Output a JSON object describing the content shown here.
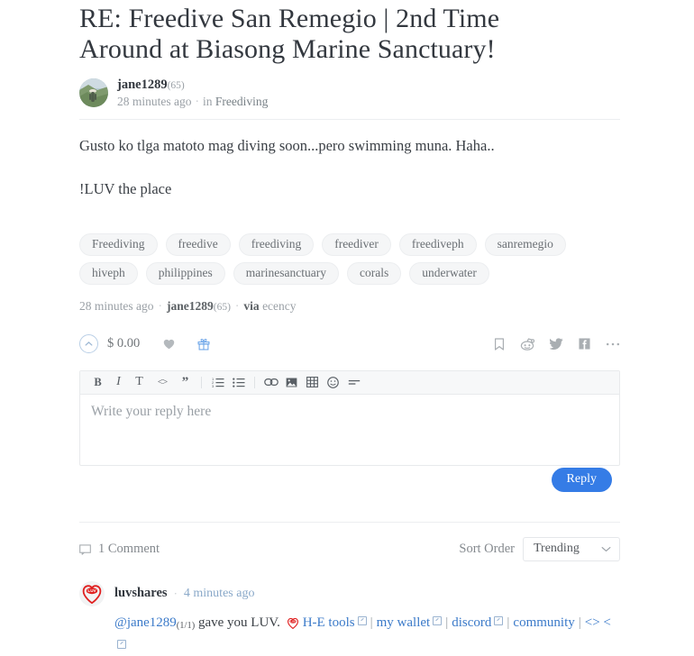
{
  "post": {
    "title": "RE: Freedive San Remegio | 2nd Time Around at Biasong Marine Sanctuary!",
    "author": "jane1289",
    "author_reputation": "(65)",
    "timestamp": "28 minutes ago",
    "in_label": "in",
    "community": "Freediving",
    "avatar_alt": "jane1289-avatar",
    "body_paragraphs": [
      "Gusto ko tlga matoto mag diving soon...pero swimming muna. Haha..",
      "!LUV the place"
    ],
    "tags": [
      "Freediving",
      "freedive",
      "freediving",
      "freediver",
      "freediveph",
      "sanremegio",
      "hiveph",
      "philippines",
      "marinesanctuary",
      "corals",
      "underwater"
    ],
    "footer_meta": {
      "timestamp": "28 minutes ago",
      "author": "jane1289",
      "reputation": "(65)",
      "via_label": "via",
      "via_app": "ecency"
    }
  },
  "actions": {
    "upvote_icon": "chevron-up-circle-icon",
    "payout": "$ 0.00",
    "heart_icon": "heart-icon",
    "gift_icon": "gift-icon",
    "share": [
      {
        "name": "bookmark-icon",
        "label": "Bookmark"
      },
      {
        "name": "reddit-icon",
        "label": "Reddit"
      },
      {
        "name": "twitter-icon",
        "label": "Twitter"
      },
      {
        "name": "facebook-icon",
        "label": "Facebook"
      },
      {
        "name": "more-icon",
        "label": "More"
      }
    ]
  },
  "editor": {
    "toolbar": [
      {
        "name": "bold-icon",
        "glyph": "B"
      },
      {
        "name": "italic-icon",
        "glyph": "I"
      },
      {
        "name": "text-style-icon",
        "glyph": "T"
      },
      {
        "name": "code-icon",
        "glyph": "<>"
      },
      {
        "name": "quote-icon",
        "glyph": "”"
      },
      {
        "name": "ordered-list-icon",
        "glyph": ""
      },
      {
        "name": "unordered-list-icon",
        "glyph": ""
      },
      {
        "name": "link-icon",
        "glyph": ""
      },
      {
        "name": "image-icon",
        "glyph": ""
      },
      {
        "name": "table-icon",
        "glyph": ""
      },
      {
        "name": "emoji-icon",
        "glyph": ""
      },
      {
        "name": "divider-icon",
        "glyph": ""
      }
    ],
    "placeholder": "Write your reply here",
    "value": "",
    "reply_label": "Reply"
  },
  "comments_header": {
    "count_label": "1 Comment",
    "comment_icon": "comment-bubble-icon",
    "sort_label": "Sort Order",
    "sort_value": "Trending",
    "sort_options": [
      "Trending"
    ]
  },
  "comment": {
    "author": "luvshares",
    "timestamp": "4 minutes ago",
    "avatar_alt": "luvshares-luv-heart-avatar",
    "text_mention": "@jane1289",
    "text_fraction": "(1/1)",
    "text_after": " gave you LUV.",
    "links": [
      {
        "label": "H-E tools",
        "external": true
      },
      {
        "label": "my wallet",
        "external": true
      },
      {
        "label": "discord",
        "external": true
      },
      {
        "label": "community",
        "external": false
      },
      {
        "label": "<>",
        "external": false
      },
      {
        "label": "<",
        "external": true
      }
    ]
  },
  "colors": {
    "accent_blue": "#357ce6",
    "link_blue": "#3b7ac9",
    "luv_red": "#e02020",
    "muted_gray": "#9aa0a6",
    "tag_bg": "#f5f6f7"
  }
}
